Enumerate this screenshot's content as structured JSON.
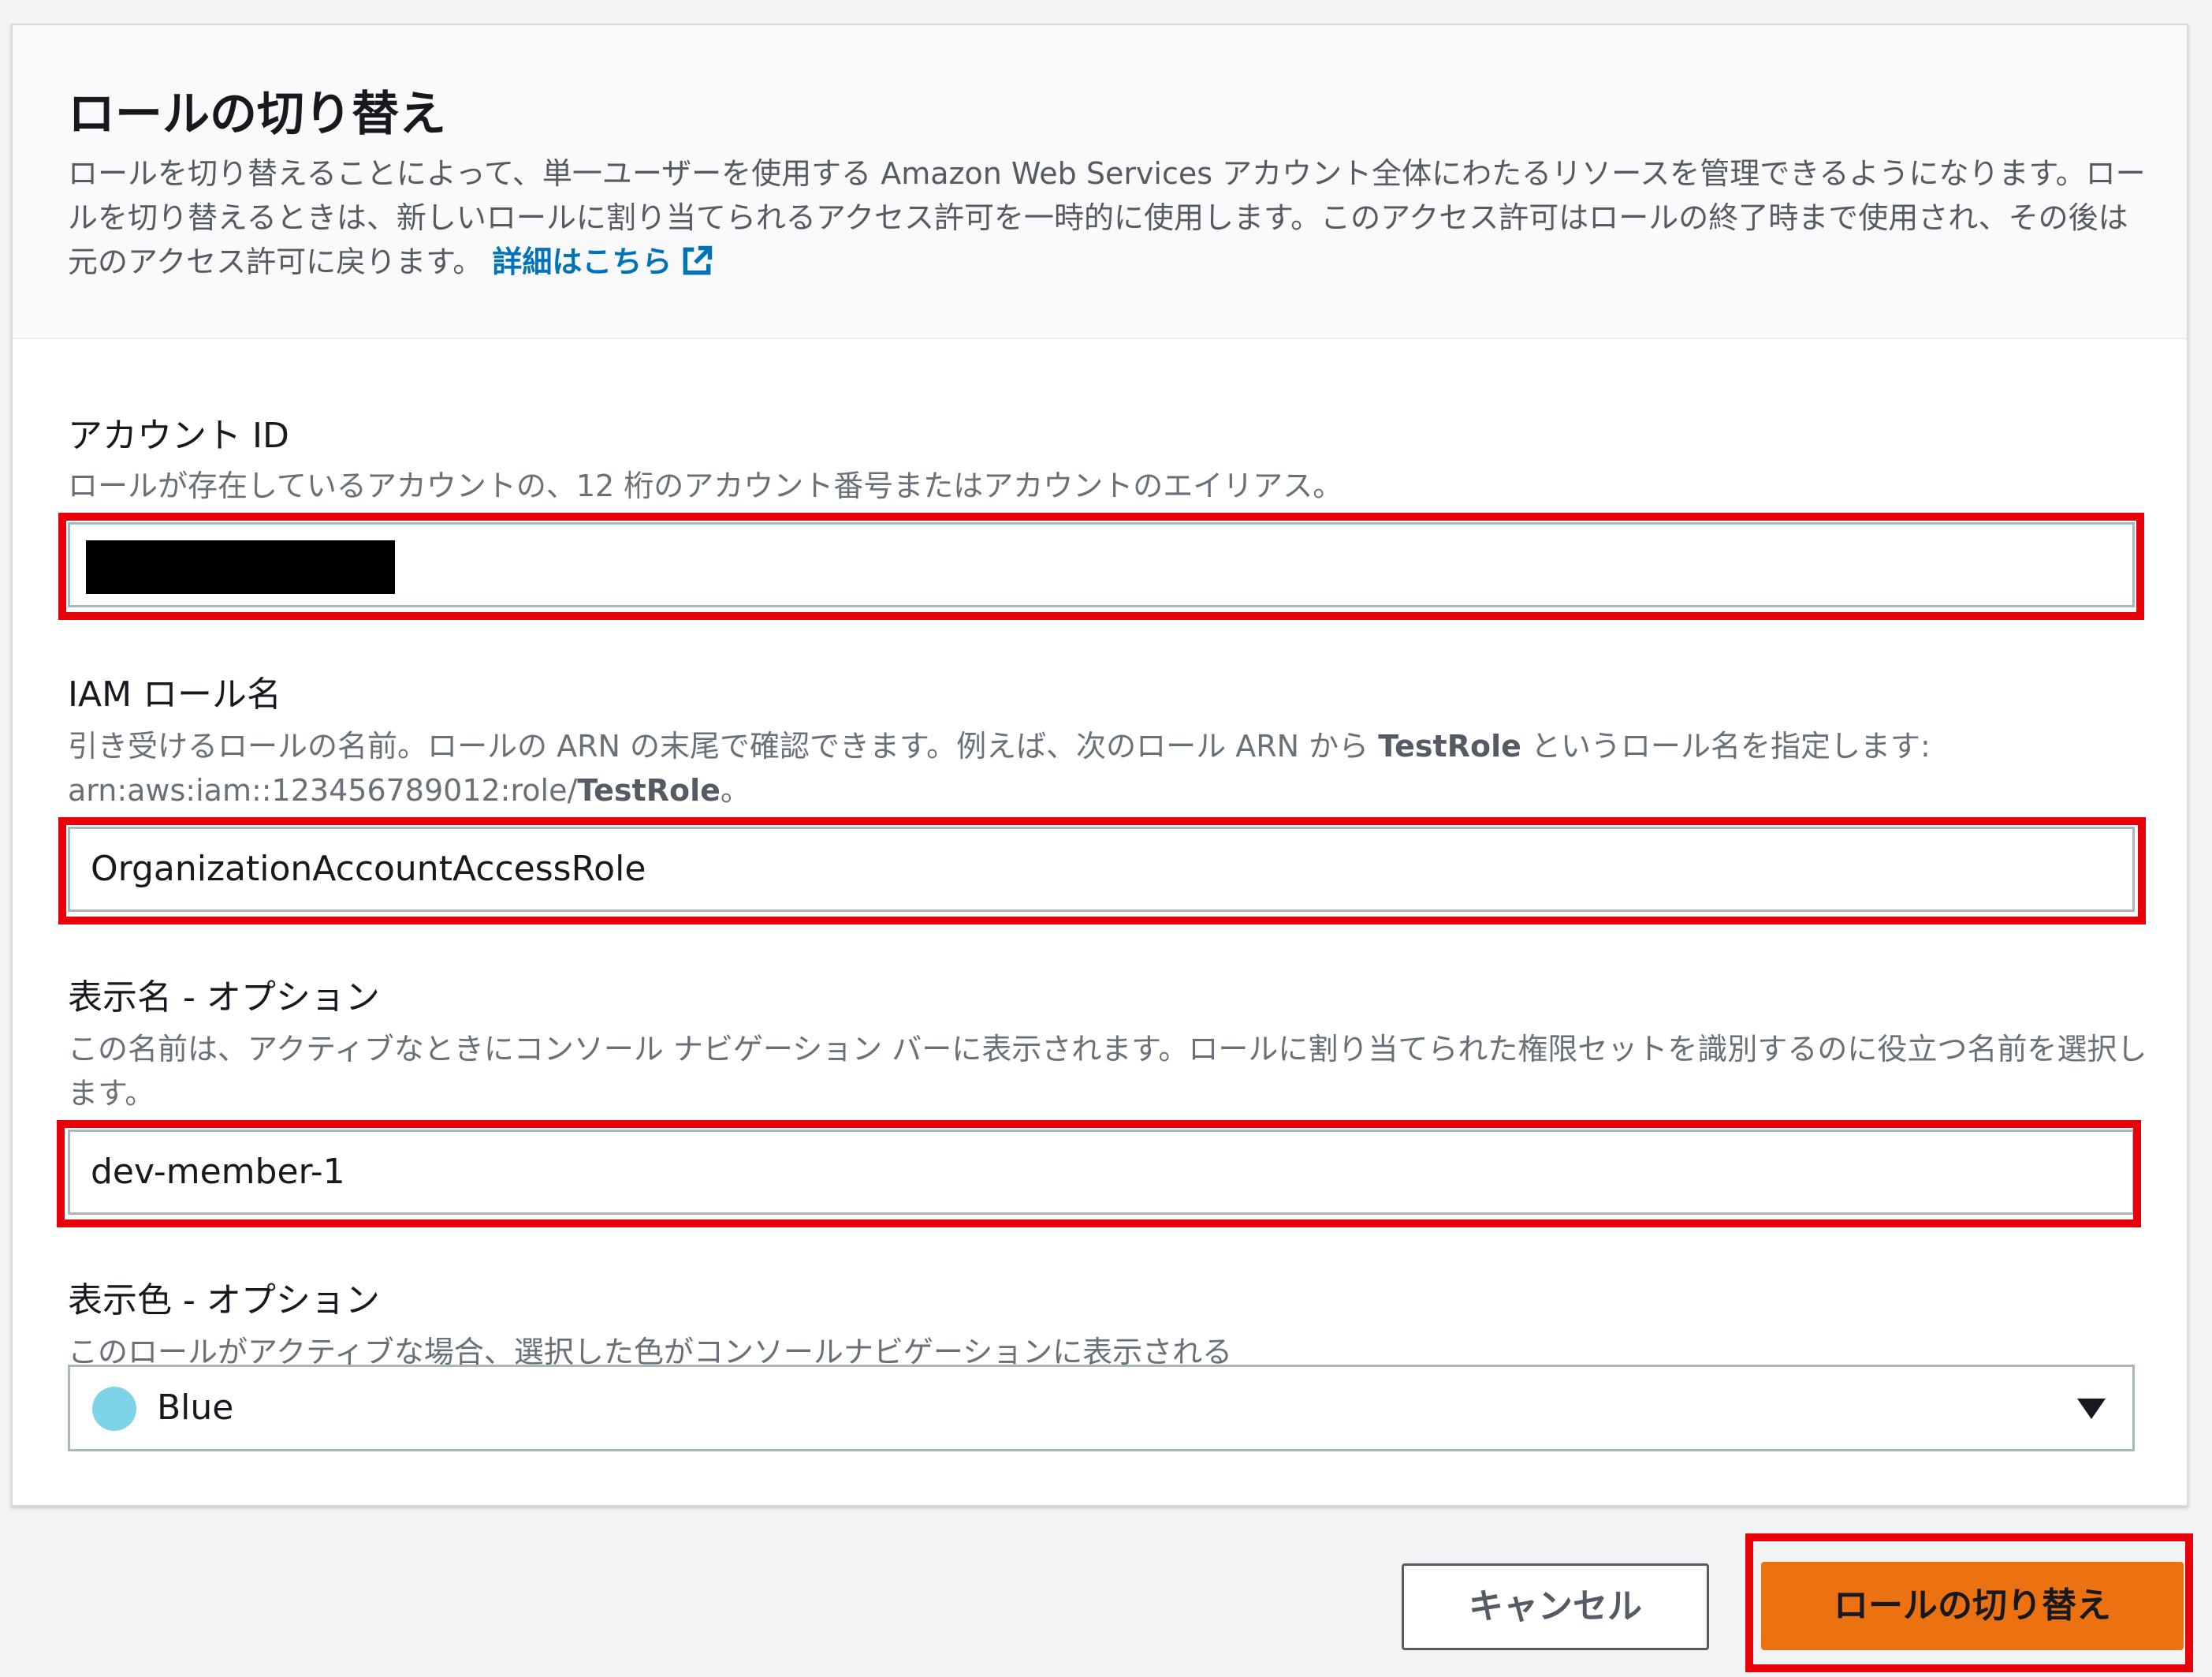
{
  "header": {
    "title": "ロールの切り替え",
    "description": "ロールを切り替えることによって、単一ユーザーを使用する Amazon Web Services アカウント全体にわたるリソースを管理できるようになります。ロールを切り替えるときは、新しいロールに割り当てられるアクセス許可を一時的に使用します。このアクセス許可はロールの終了時まで使用され、その後は元のアクセス許可に戻ります。",
    "learn_more_link": "詳細はこちら",
    "link_icon": "external-link-icon"
  },
  "fields": {
    "account_id": {
      "label": "アカウント ID",
      "description": "ロールが存在しているアカウントの、12 桁のアカウント番号またはアカウントのエイリアス。",
      "value_redacted": true
    },
    "iam_role": {
      "label": "IAM ロール名",
      "description_before": "引き受けるロールの名前。ロールの ARN の末尾で確認できます。例えば、次のロール ARN から",
      "description_bold": "TestRole",
      "description_after": "というロール名を指定します:",
      "arn_prefix": "arn:aws:iam::123456789012:role/",
      "arn_bold": "TestRole",
      "arn_suffix": "。",
      "value": "OrganizationAccountAccessRole"
    },
    "display_name": {
      "label": "表示名 - オプション",
      "description": "この名前は、アクティブなときにコンソール ナビゲーション バーに表示されます。ロールに割り当てられた権限セットを識別するのに役立つ名前を選択します。",
      "value": "dev-member-1"
    },
    "display_color": {
      "label": "表示色 - オプション",
      "description": "このロールがアクティブな場合、選択した色がコンソールナビゲーションに表示される",
      "selected": "Blue",
      "swatch_color": "#7dd3e8",
      "dropdown_icon": "chevron-down-icon"
    }
  },
  "actions": {
    "cancel_label": "キャンセル",
    "submit_label": "ロールの切り替え"
  },
  "colors": {
    "primary_button": "#ec7211",
    "link": "#0073bb",
    "highlight": "#e8000b"
  }
}
